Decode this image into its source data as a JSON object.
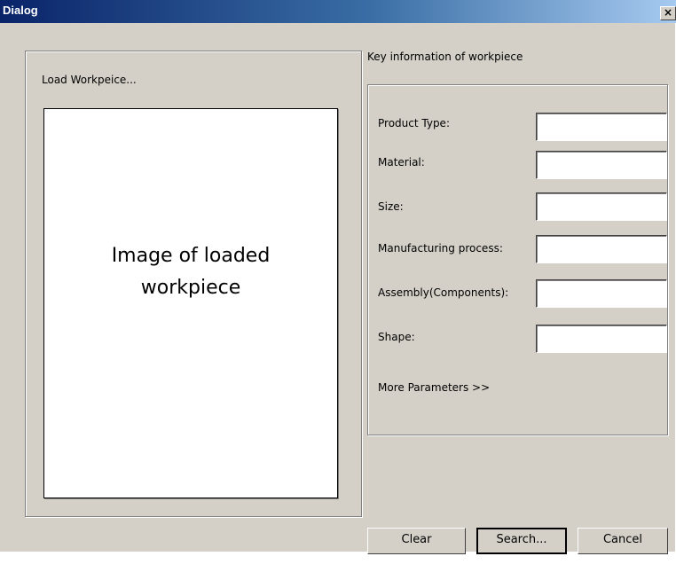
{
  "window": {
    "title": "Dialog",
    "close_symbol": "×"
  },
  "left": {
    "group_label": "Load Workpeice...",
    "image_text_line1": "Image of loaded",
    "image_text_line2": "workpiece"
  },
  "right": {
    "group_title": "Key information of workpiece",
    "fields": [
      {
        "label": "Product Type:",
        "value": ""
      },
      {
        "label": "Material:",
        "value": ""
      },
      {
        "label": "Size:",
        "value": ""
      },
      {
        "label": "Manufacturing process:",
        "value": ""
      },
      {
        "label": "Assembly(Components):",
        "value": ""
      },
      {
        "label": "Shape:",
        "value": ""
      }
    ],
    "more_params": "More Parameters >>"
  },
  "buttons": {
    "clear": "Clear",
    "search": "Search...",
    "cancel": "Cancel"
  }
}
